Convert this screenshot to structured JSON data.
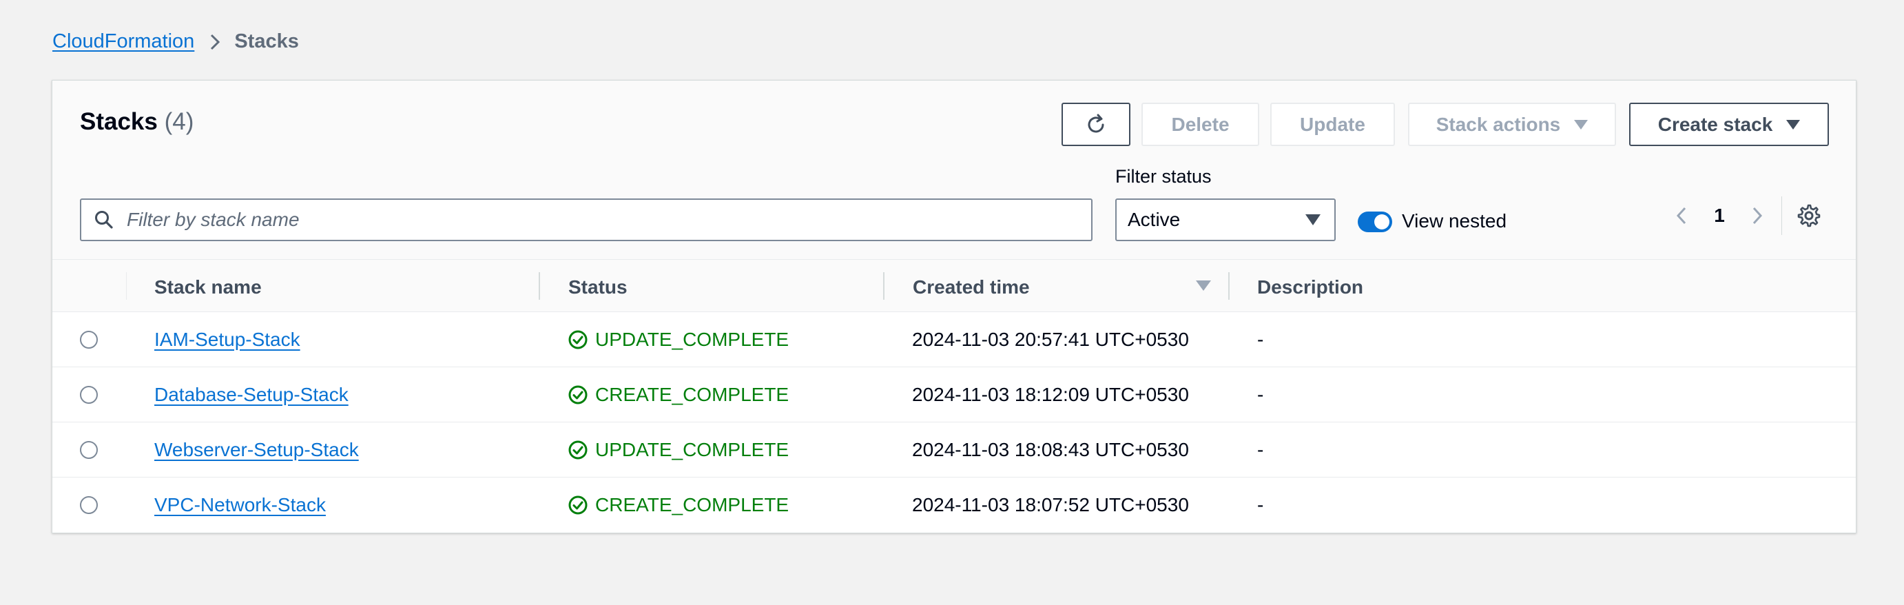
{
  "breadcrumb": {
    "root": "CloudFormation",
    "current": "Stacks"
  },
  "panel": {
    "title": "Stacks",
    "count": "(4)"
  },
  "toolbar": {
    "delete_label": "Delete",
    "update_label": "Update",
    "stack_actions_label": "Stack actions",
    "create_stack_label": "Create stack"
  },
  "search": {
    "placeholder": "Filter by stack name",
    "value": ""
  },
  "filter": {
    "label": "Filter status",
    "selected": "Active"
  },
  "nested": {
    "label": "View nested",
    "enabled": true
  },
  "pagination": {
    "current_page": "1"
  },
  "table": {
    "columns": [
      "Stack name",
      "Status",
      "Created time",
      "Description"
    ],
    "rows": [
      {
        "name": "IAM-Setup-Stack",
        "status": "UPDATE_COMPLETE",
        "created": "2024-11-03 20:57:41 UTC+0530",
        "description": "-"
      },
      {
        "name": "Database-Setup-Stack",
        "status": "CREATE_COMPLETE",
        "created": "2024-11-03 18:12:09 UTC+0530",
        "description": "-"
      },
      {
        "name": "Webserver-Setup-Stack",
        "status": "UPDATE_COMPLETE",
        "created": "2024-11-03 18:08:43 UTC+0530",
        "description": "-"
      },
      {
        "name": "VPC-Network-Stack",
        "status": "CREATE_COMPLETE",
        "created": "2024-11-03 18:07:52 UTC+0530",
        "description": "-"
      }
    ]
  },
  "colors": {
    "link": "#0972d3",
    "success": "#037f0c",
    "toggle": "#0972d3"
  }
}
